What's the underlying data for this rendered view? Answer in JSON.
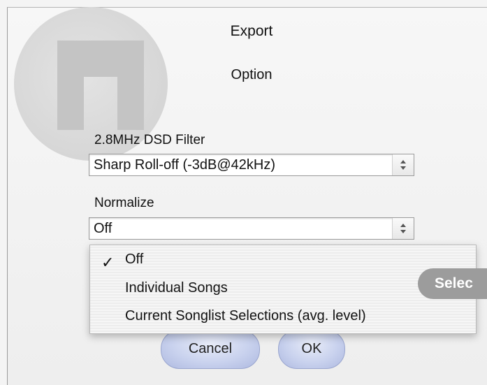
{
  "dialog": {
    "title": "Export",
    "subtitle": "Option"
  },
  "dsd_filter": {
    "label": "2.8MHz DSD Filter",
    "value": "Sharp Roll-off (-3dB@42kHz)"
  },
  "normalize": {
    "label": "Normalize",
    "value": "Off",
    "options": [
      {
        "label": "Off",
        "checked": true
      },
      {
        "label": "Individual Songs",
        "checked": false
      },
      {
        "label": "Current Songlist Selections (avg. level)",
        "checked": false
      }
    ]
  },
  "buttons": {
    "cancel": "Cancel",
    "ok": "OK"
  },
  "tooltip": {
    "text": "Selec"
  },
  "icons": {
    "check": "check-icon",
    "stepper": "up-down-arrows-icon",
    "logo": "app-logo-icon"
  }
}
